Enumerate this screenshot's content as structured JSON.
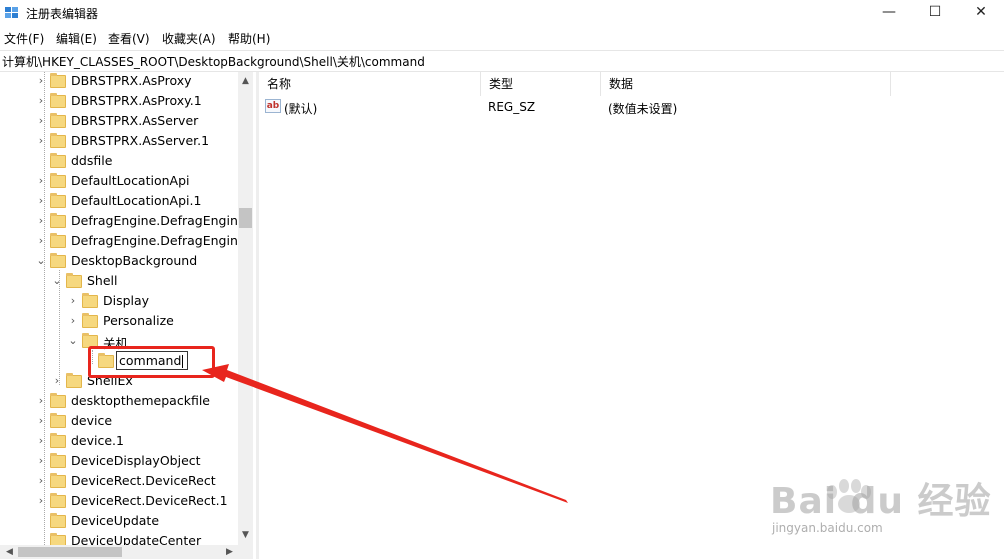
{
  "window": {
    "title": "注册表编辑器",
    "minimize_glyph": "—",
    "maximize_glyph": "☐",
    "close_glyph": "✕"
  },
  "menu": [
    {
      "label": "文件(F)"
    },
    {
      "label": "编辑(E)"
    },
    {
      "label": "查看(V)"
    },
    {
      "label": "收藏夹(A)"
    },
    {
      "label": "帮助(H)"
    }
  ],
  "address": {
    "path": "计算机\\HKEY_CLASSES_ROOT\\DesktopBackground\\Shell\\关机\\command"
  },
  "tree": {
    "items": [
      {
        "label": "DBRSTPRX.AsProxy",
        "expander": "›"
      },
      {
        "label": "DBRSTPRX.AsProxy.1",
        "expander": "›"
      },
      {
        "label": "DBRSTPRX.AsServer",
        "expander": "›"
      },
      {
        "label": "DBRSTPRX.AsServer.1",
        "expander": "›"
      },
      {
        "label": "ddsfile",
        "expander": ""
      },
      {
        "label": "DefaultLocationApi",
        "expander": "›"
      },
      {
        "label": "DefaultLocationApi.1",
        "expander": "›"
      },
      {
        "label": "DefragEngine.DefragEngine",
        "expander": "›"
      },
      {
        "label": "DefragEngine.DefragEngine.",
        "expander": "›"
      },
      {
        "label": "DesktopBackground",
        "expander": "⌄"
      },
      {
        "label": "Shell",
        "expander": "⌄"
      },
      {
        "label": "Display",
        "expander": "›"
      },
      {
        "label": "Personalize",
        "expander": "›"
      },
      {
        "label": "关机",
        "expander": "⌄"
      },
      {
        "label": "command",
        "expander": ""
      },
      {
        "label": "ShellEx",
        "expander": "›"
      },
      {
        "label": "desktopthemepackfile",
        "expander": "›"
      },
      {
        "label": "device",
        "expander": "›"
      },
      {
        "label": "device.1",
        "expander": "›"
      },
      {
        "label": "DeviceDisplayObject",
        "expander": "›"
      },
      {
        "label": "DeviceRect.DeviceRect",
        "expander": "›"
      },
      {
        "label": "DeviceRect.DeviceRect.1",
        "expander": "›"
      },
      {
        "label": "DeviceUpdate",
        "expander": ""
      },
      {
        "label": "DeviceUpdateCenter",
        "expander": ""
      }
    ],
    "scroll_up_glyph": "▲",
    "scroll_down_glyph": "▼",
    "scroll_left_glyph": "◀",
    "scroll_right_glyph": "▶"
  },
  "list": {
    "columns": [
      {
        "label": "名称"
      },
      {
        "label": "类型"
      },
      {
        "label": "数据"
      }
    ],
    "rows": [
      {
        "icon": "ab",
        "name": "(默认)",
        "type": "REG_SZ",
        "data": "(数值未设置)"
      }
    ]
  },
  "annotation": {
    "color": "#e8251d"
  },
  "watermark": {
    "brand": "Bai du 经验",
    "url": "jingyan.baidu.com"
  },
  "colors": {
    "folder": "#f6d87f",
    "annotation_red": "#e8251d"
  }
}
